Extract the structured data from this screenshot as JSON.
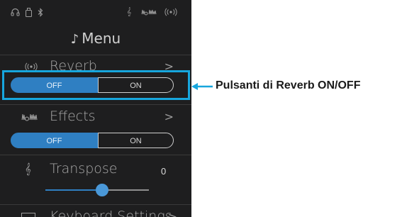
{
  "statusbar": {
    "icons": [
      "headphones-icon",
      "usb-drive-icon",
      "bluetooth-icon",
      "transpose-icon",
      "effects-icon",
      "reverb-icon"
    ]
  },
  "menu": {
    "title": "Menu",
    "reverb": {
      "label": "Reverb",
      "chevron": ">",
      "toggle": {
        "off_label": "OFF",
        "on_label": "ON",
        "selected": "OFF"
      }
    },
    "effects": {
      "label": "Effects",
      "chevron": ">",
      "toggle": {
        "off_label": "OFF",
        "on_label": "ON",
        "selected": "OFF"
      }
    },
    "transpose": {
      "label": "Transpose",
      "value": "0",
      "slider_level": 0.55
    },
    "keyboard_settings": {
      "label": "Keyboard Settings",
      "chevron": ">"
    }
  },
  "callout": {
    "text": "Pulsanti di Reverb ON/OFF"
  },
  "colors": {
    "screen_bg": "#1e1e1f",
    "accent_blue": "#2f7fc2",
    "highlight": "#17a6dd"
  }
}
